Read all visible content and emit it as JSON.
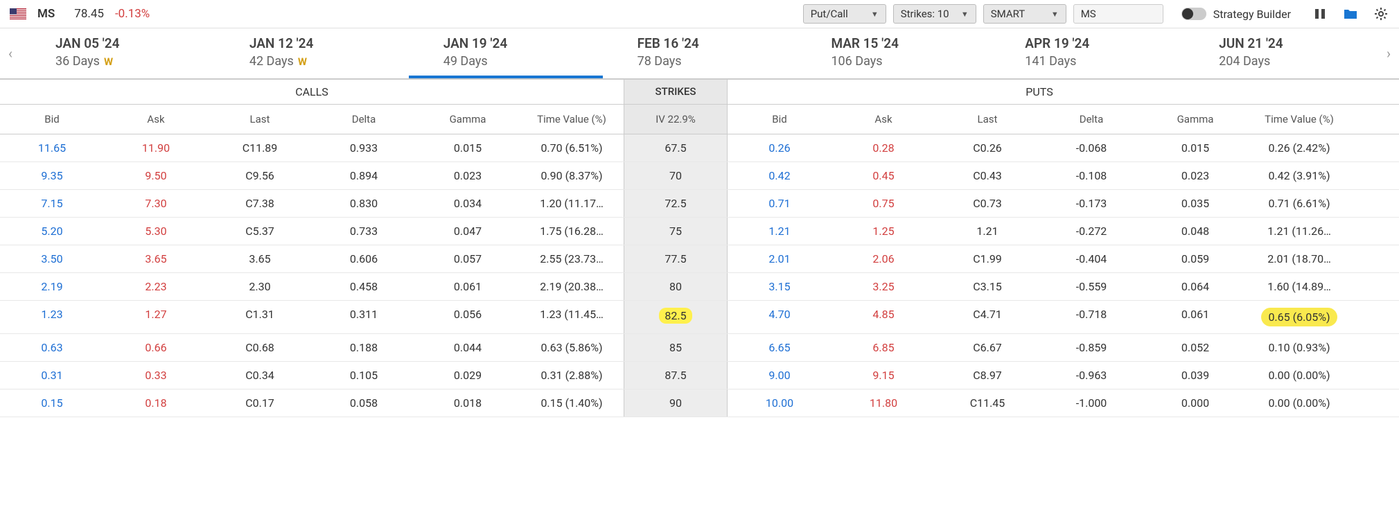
{
  "header": {
    "ticker": "MS",
    "price": "78.45",
    "change": "-0.13%",
    "dropdowns": {
      "putcall": "Put/Call",
      "strikes": "Strikes: 10",
      "exchange": "SMART"
    },
    "symbol_input": "MS",
    "strategy_label": "Strategy Builder"
  },
  "expiries": [
    {
      "date": "JAN 05 '24",
      "days": "36 Days",
      "w": true
    },
    {
      "date": "JAN 12 '24",
      "days": "42 Days",
      "w": true
    },
    {
      "date": "JAN 19 '24",
      "days": "49 Days",
      "w": false,
      "selected": true
    },
    {
      "date": "FEB 16 '24",
      "days": "78 Days",
      "w": false
    },
    {
      "date": "MAR 15 '24",
      "days": "106 Days",
      "w": false
    },
    {
      "date": "APR 19 '24",
      "days": "141 Days",
      "w": false
    },
    {
      "date": "JUN 21 '24",
      "days": "204 Days",
      "w": false
    }
  ],
  "sections": {
    "calls": "CALLS",
    "strikes": "STRIKES",
    "puts": "PUTS"
  },
  "columns": {
    "bid": "Bid",
    "ask": "Ask",
    "last": "Last",
    "delta": "Delta",
    "gamma": "Gamma",
    "tv": "Time Value (%)",
    "iv": "IV 22.9%"
  },
  "rows": [
    {
      "cb": "11.65",
      "ca": "11.90",
      "cl": "C11.89",
      "cd": "0.933",
      "cg": "0.015",
      "ctv": "0.70 (6.51%)",
      "strike": "67.5",
      "pb": "0.26",
      "pa": "0.28",
      "pl": "C0.26",
      "pd": "-0.068",
      "pg": "0.015",
      "ptv": "0.26 (2.42%)"
    },
    {
      "cb": "9.35",
      "ca": "9.50",
      "cl": "C9.56",
      "cd": "0.894",
      "cg": "0.023",
      "ctv": "0.90 (8.37%)",
      "strike": "70",
      "pb": "0.42",
      "pa": "0.45",
      "pl": "C0.43",
      "pd": "-0.108",
      "pg": "0.023",
      "ptv": "0.42 (3.91%)"
    },
    {
      "cb": "7.15",
      "ca": "7.30",
      "cl": "C7.38",
      "cd": "0.830",
      "cg": "0.034",
      "ctv": "1.20 (11.17…",
      "strike": "72.5",
      "pb": "0.71",
      "pa": "0.75",
      "pl": "C0.73",
      "pd": "-0.173",
      "pg": "0.035",
      "ptv": "0.71 (6.61%)"
    },
    {
      "cb": "5.20",
      "ca": "5.30",
      "cl": "C5.37",
      "cd": "0.733",
      "cg": "0.047",
      "ctv": "1.75 (16.28…",
      "strike": "75",
      "pb": "1.21",
      "pa": "1.25",
      "pl": "1.21",
      "pd": "-0.272",
      "pg": "0.048",
      "ptv": "1.21 (11.26…"
    },
    {
      "cb": "3.50",
      "ca": "3.65",
      "cl": "3.65",
      "cd": "0.606",
      "cg": "0.057",
      "ctv": "2.55 (23.73…",
      "strike": "77.5",
      "pb": "2.01",
      "pa": "2.06",
      "pl": "C1.99",
      "pd": "-0.404",
      "pg": "0.059",
      "ptv": "2.01 (18.70…"
    },
    {
      "cb": "2.19",
      "ca": "2.23",
      "cl": "2.30",
      "cd": "0.458",
      "cg": "0.061",
      "ctv": "2.19 (20.38…",
      "strike": "80",
      "pb": "3.15",
      "pa": "3.25",
      "pl": "C3.15",
      "pd": "-0.559",
      "pg": "0.064",
      "ptv": "1.60 (14.89…"
    },
    {
      "cb": "1.23",
      "ca": "1.27",
      "cl": "C1.31",
      "cd": "0.311",
      "cg": "0.056",
      "ctv": "1.23 (11.45…",
      "strike": "82.5",
      "strike_hl": true,
      "pb": "4.70",
      "pa": "4.85",
      "pl": "C4.71",
      "pd": "-0.718",
      "pg": "0.061",
      "ptv": "0.65 (6.05%)",
      "ptv_hl": true
    },
    {
      "cb": "0.63",
      "ca": "0.66",
      "cl": "C0.68",
      "cd": "0.188",
      "cg": "0.044",
      "ctv": "0.63 (5.86%)",
      "strike": "85",
      "pb": "6.65",
      "pa": "6.85",
      "pl": "C6.67",
      "pd": "-0.859",
      "pg": "0.052",
      "ptv": "0.10 (0.93%)"
    },
    {
      "cb": "0.31",
      "ca": "0.33",
      "cl": "C0.34",
      "cd": "0.105",
      "cg": "0.029",
      "ctv": "0.31 (2.88%)",
      "strike": "87.5",
      "pb": "9.00",
      "pa": "9.15",
      "pl": "C8.97",
      "pd": "-0.963",
      "pg": "0.039",
      "ptv": "0.00 (0.00%)"
    },
    {
      "cb": "0.15",
      "ca": "0.18",
      "cl": "C0.17",
      "cd": "0.058",
      "cg": "0.018",
      "ctv": "0.15 (1.40%)",
      "strike": "90",
      "pb": "10.00",
      "pa": "11.80",
      "pl": "C11.45",
      "pd": "-1.000",
      "pg": "0.000",
      "ptv": "0.00 (0.00%)"
    }
  ]
}
